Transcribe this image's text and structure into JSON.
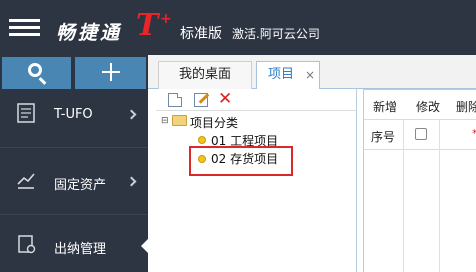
{
  "header": {
    "brand_name": "畅捷通",
    "brand_mark": "T",
    "brand_plus": "+",
    "edition": "标准版",
    "company": "激活.阿可云公司",
    "menu_icon": "hamburger-icon"
  },
  "sidebar": {
    "search_icon": "search-icon",
    "add_icon": "plus-icon",
    "items": [
      {
        "label": "T-UFO",
        "icon": "report-icon"
      },
      {
        "label": "固定资产",
        "icon": "asset-icon"
      },
      {
        "label": "出纳管理",
        "icon": "cashier-icon"
      }
    ]
  },
  "tabs": [
    {
      "label": "我的桌面"
    },
    {
      "label": "项目",
      "close": "×"
    }
  ],
  "tree": {
    "toolbar": [
      "new-doc-icon",
      "edit-icon",
      "delete-icon"
    ],
    "delete_glyph": "✕",
    "toggle": "⊟",
    "root": "项目分类",
    "children": [
      {
        "label": "01 工程项目"
      },
      {
        "label": "02 存货项目",
        "highlighted": true
      }
    ]
  },
  "grid": {
    "toolbar": [
      "新增",
      "修改",
      "删除"
    ],
    "columns": [
      "序号"
    ],
    "header_mark": "*"
  },
  "colors": {
    "topbar": "#2d3542",
    "action_button": "#4a86b4",
    "tab_active_text": "#2a7fcf",
    "highlight_border": "#d82a2a",
    "node_bullet": "#f3c51b"
  }
}
